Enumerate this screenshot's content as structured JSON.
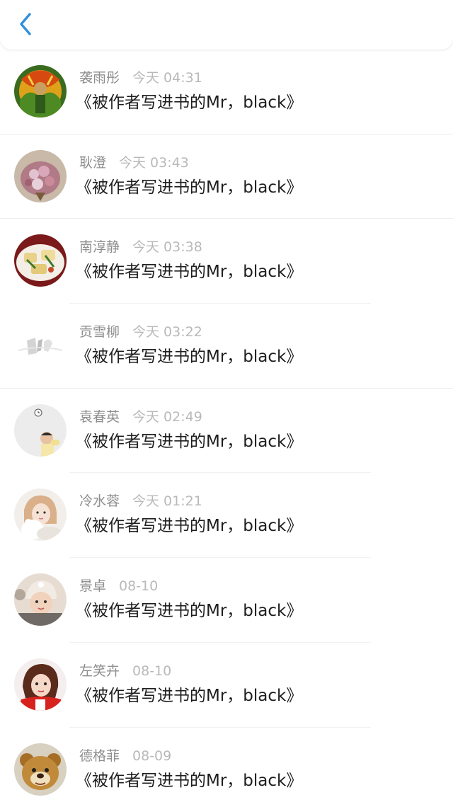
{
  "header": {
    "back_icon": "chevron-left-icon",
    "accent_color": "#2f8fe0"
  },
  "messages": [
    {
      "name": "袭雨彤",
      "time": "今天 04:31",
      "title": "《被作者写进书的Mr，black》",
      "avatar": "avatar-green-costume"
    },
    {
      "name": "耿澄",
      "time": "今天 03:43",
      "title": "《被作者写进书的Mr，black》",
      "avatar": "avatar-flower-bouquet"
    },
    {
      "name": "南淳静",
      "time": "今天 03:38",
      "title": "《被作者写进书的Mr，black》",
      "avatar": "avatar-food-plate"
    },
    {
      "name": "贡雪柳",
      "time": "今天 03:22",
      "title": "《被作者写进书的Mr，black》",
      "avatar": "avatar-sketch-white"
    },
    {
      "name": "袁春英",
      "time": "今天 02:49",
      "title": "《被作者写进书的Mr，black》",
      "avatar": "avatar-child-clock"
    },
    {
      "name": "冷水蓉",
      "time": "今天 01:21",
      "title": "《被作者写进书的Mr，black》",
      "avatar": "avatar-girl-plush"
    },
    {
      "name": "景卓",
      "time": "08-10",
      "title": "《被作者写进书的Mr，black》",
      "avatar": "avatar-baby-hat"
    },
    {
      "name": "左笑卉",
      "time": "08-10",
      "title": "《被作者写进书的Mr，black》",
      "avatar": "avatar-girl-red"
    },
    {
      "name": "德格菲",
      "time": "08-09",
      "title": "《被作者写进书的Mr，black》",
      "avatar": "avatar-teddy-bear"
    }
  ]
}
